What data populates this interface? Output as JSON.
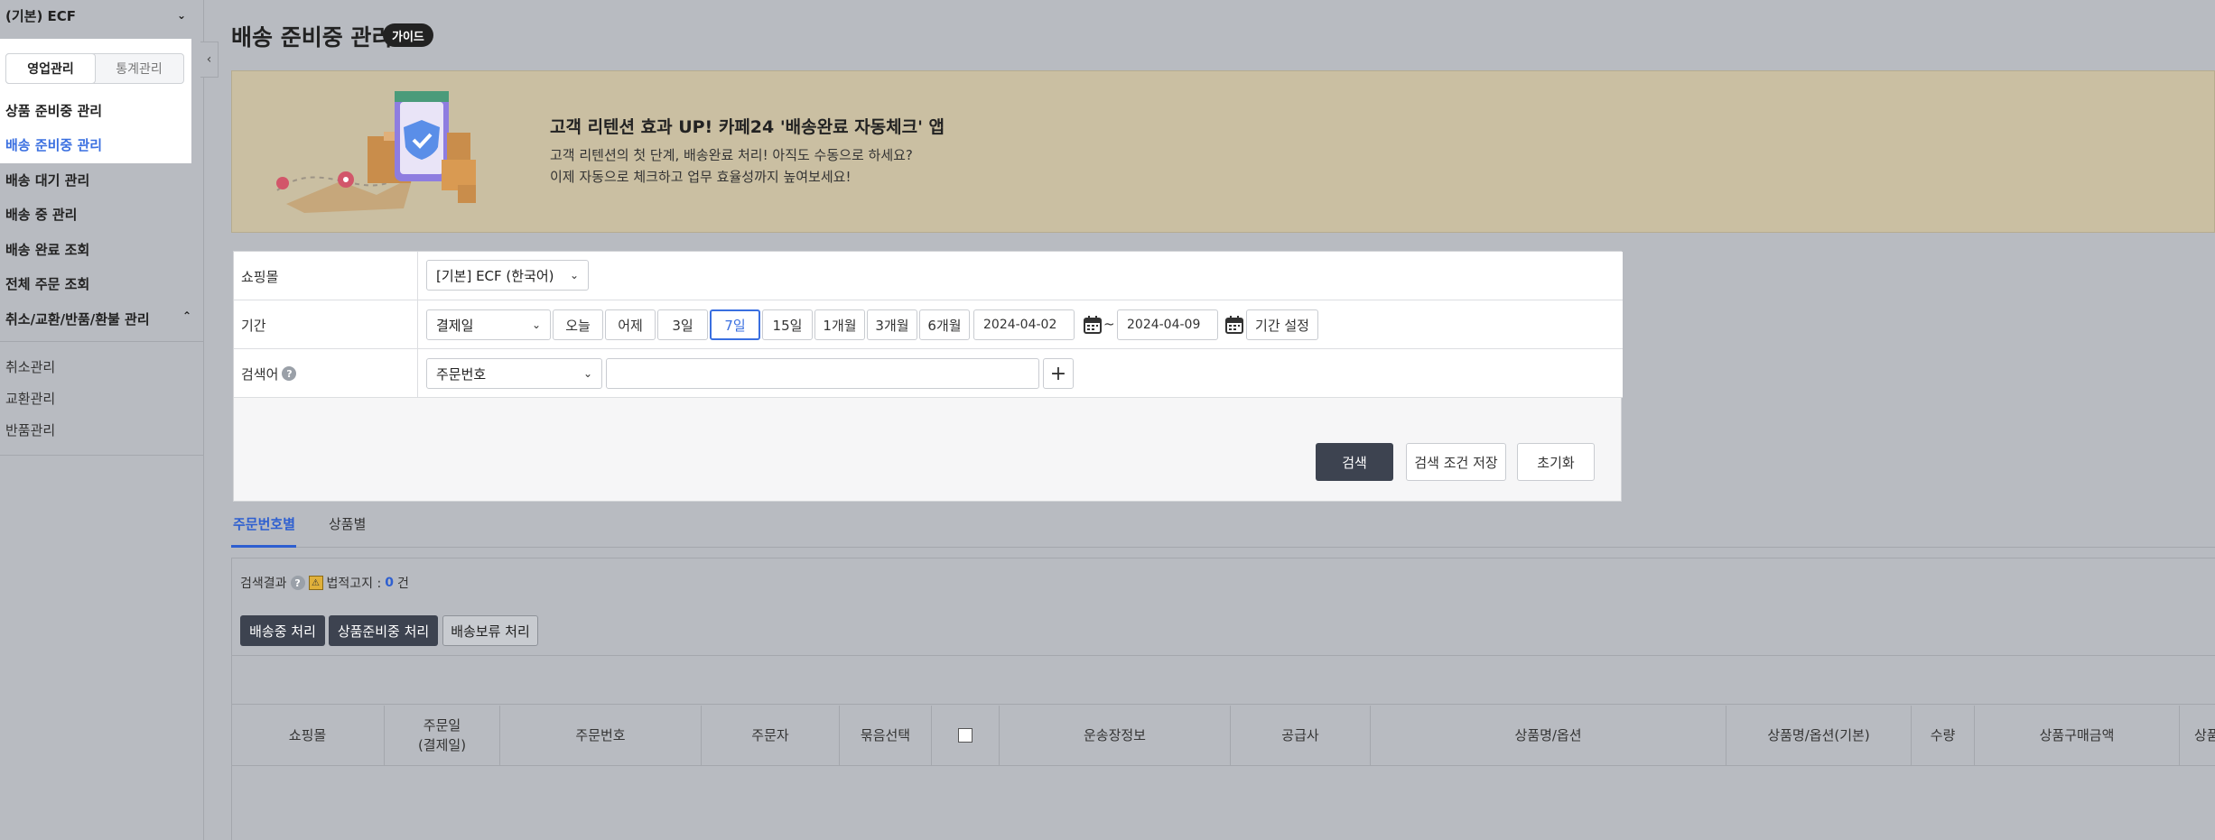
{
  "sidebar": {
    "store": "(기본) ECF",
    "tabs": [
      "영업관리",
      "통계관리"
    ],
    "links": [
      "상품 준비중 관리",
      "배송 준비중 관리"
    ],
    "menu": [
      "배송 대기 관리",
      "배송 중 관리",
      "배송 완료 조회",
      "전체 주문 조회",
      "취소/교환/반품/환불 관리"
    ],
    "sub": [
      "취소관리",
      "교환관리",
      "반품관리"
    ]
  },
  "page": {
    "title": "배송 준비중 관리",
    "guide": "가이드"
  },
  "banner": {
    "title": "고객 리텐션 효과 UP! 카페24 '배송완료 자동체크' 앱",
    "line1": "고객 리텐션의 첫 단계, 배송완료 처리! 아직도 수동으로 하세요?",
    "line2": "이제 자동으로 체크하고 업무 효율성까지 높여보세요!"
  },
  "search": {
    "mall_label": "쇼핑몰",
    "mall_value": "[기본] ECF (한국어)",
    "period_label": "기간",
    "period_type": "결제일",
    "quick": [
      "오늘",
      "어제",
      "3일",
      "7일",
      "15일",
      "1개월",
      "3개월",
      "6개월"
    ],
    "start_date": "2024-04-02",
    "end_date": "2024-04-09",
    "tilde": "~",
    "period_set": "기간 설정",
    "keyword_label": "검색어",
    "keyword_type": "주문번호",
    "search_btn": "검색",
    "save_btn": "검색 조건 저장",
    "reset_btn": "초기화"
  },
  "results": {
    "tabs": [
      "주문번호별",
      "상품별"
    ],
    "label": "검색결과",
    "notice": "법적고지 :",
    "count": "0",
    "unit": "건",
    "actions": [
      "배송중 처리",
      "상품준비중 처리",
      "배송보류 처리"
    ],
    "columns": [
      "쇼핑몰",
      "주문일\n(결제일)",
      "주문번호",
      "주문자",
      "묶음선택",
      "",
      "운송장정보",
      "공급사",
      "상품명/옵션",
      "상품명/옵션(기본)",
      "수량",
      "상품구매금액",
      "상품"
    ]
  }
}
